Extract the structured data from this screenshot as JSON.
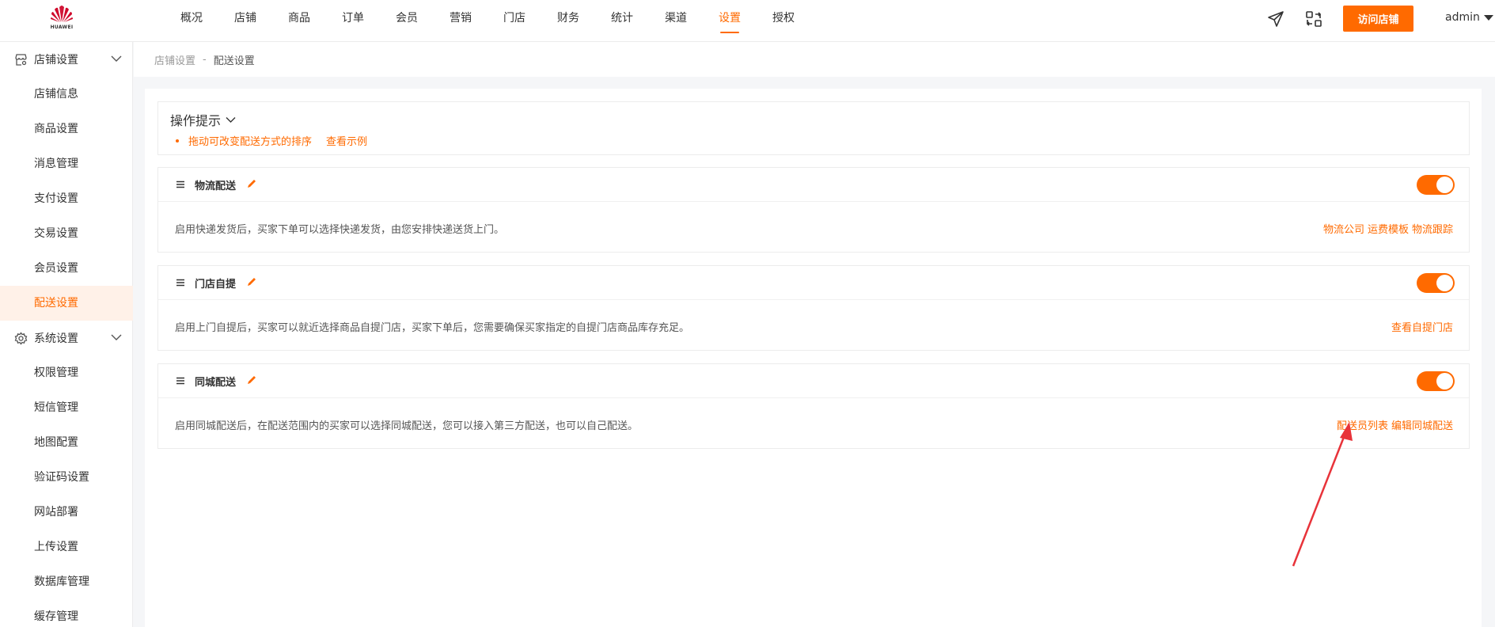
{
  "topbar": {
    "logo_text": "HUAWEI",
    "nav": [
      "概况",
      "店铺",
      "商品",
      "订单",
      "会员",
      "营销",
      "门店",
      "财务",
      "统计",
      "渠道",
      "设置",
      "授权"
    ],
    "active_nav": "设置",
    "visit_store_label": "访问店铺",
    "user": "admin"
  },
  "sidebar": {
    "group1": {
      "label": "店铺设置",
      "items": [
        "店铺信息",
        "商品设置",
        "消息管理",
        "支付设置",
        "交易设置",
        "会员设置",
        "配送设置"
      ]
    },
    "group2": {
      "label": "系统设置",
      "items": [
        "权限管理",
        "短信管理",
        "地图配置",
        "验证码设置",
        "网站部署",
        "上传设置",
        "数据库管理",
        "缓存管理"
      ]
    },
    "active_item": "配送设置"
  },
  "breadcrumb": {
    "parent": "店铺设置",
    "sep": "-",
    "current": "配送设置"
  },
  "tips": {
    "title": "操作提示",
    "line": "拖动可改变配送方式的排序",
    "example_link": "查看示例"
  },
  "cards": [
    {
      "title": "物流配送",
      "enabled": true,
      "desc": "启用快递发货后，买家下单可以选择快递发货，由您安排快递送货上门。",
      "links": [
        "物流公司",
        "运费模板",
        "物流跟踪"
      ]
    },
    {
      "title": "门店自提",
      "enabled": true,
      "desc": "启用上门自提后，买家可以就近选择商品自提门店，买家下单后，您需要确保买家指定的自提门店商品库存充足。",
      "links": [
        "查看自提门店"
      ]
    },
    {
      "title": "同城配送",
      "enabled": true,
      "desc": "启用同城配送后，在配送范围内的买家可以选择同城配送，您可以接入第三方配送，也可以自己配送。",
      "links": [
        "配送员列表",
        "编辑同城配送"
      ]
    }
  ],
  "colors": {
    "accent": "#ff6a00",
    "annotation": "#e8333a",
    "logo": "#cf0a2c"
  }
}
